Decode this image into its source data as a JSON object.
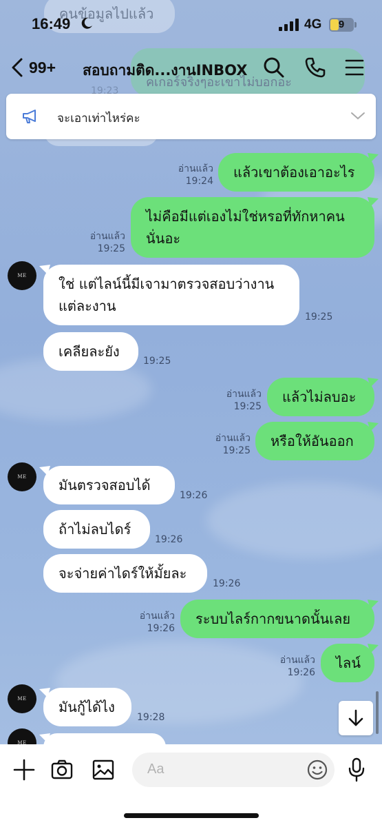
{
  "status_bar": {
    "time": "16:49",
    "network": "4G",
    "battery": "9"
  },
  "header": {
    "back_count": "99+",
    "title": "สอบถามติด...งานINBOX"
  },
  "announcement": {
    "text": "จะเอาเท่าไหร่คะ"
  },
  "background_text": {
    "top_left": "คนข้อมูลไปแล้ว",
    "top_right": "คเกอร์จริงๆอะเขาไม่บอกอะ",
    "time_19_23": "19:23"
  },
  "avatar_label": "ME",
  "messages": [
    {
      "dir": "out",
      "text": "แล้วเขาต้องเอาอะไร",
      "read": "อ่านแล้ว",
      "time": "19:24"
    },
    {
      "dir": "out",
      "text": "ไม่คือมีแต่เองไม่ใช่หรอที่ทักหาคน นั่นอะ",
      "read": "อ่านแล้ว",
      "time": "19:25"
    },
    {
      "dir": "in",
      "text": "ใช่ แต่ไลน์นี้มีเจามาตรวจสอบว่างาน แต่ละงาน",
      "time": "19:25"
    },
    {
      "dir": "in",
      "text": "เคลียละยัง",
      "time": "19:25"
    },
    {
      "dir": "out",
      "text": "แล้วไม่ลบอะ",
      "read": "อ่านแล้ว",
      "time": "19:25"
    },
    {
      "dir": "out",
      "text": "หรือให้อันออก",
      "read": "อ่านแล้ว",
      "time": "19:25"
    },
    {
      "dir": "in",
      "text": "มันตรวจสอบได้",
      "time": "19:26"
    },
    {
      "dir": "in",
      "text": "ถ้าไม่ลบไดร์",
      "time": "19:26"
    },
    {
      "dir": "in",
      "text": "จะจ่ายค่าไดร์ให้มั้ยละ",
      "time": "19:26"
    },
    {
      "dir": "out",
      "text": "ระบบไลร์กากขนาดนั้นเลย",
      "read": "อ่านแล้ว",
      "time": "19:26"
    },
    {
      "dir": "out",
      "text": "ไลน์",
      "read": "อ่านแล้ว",
      "time": "19:26"
    },
    {
      "dir": "in",
      "text": "มันกู้ได้ไง",
      "time": "19:28"
    }
  ],
  "input": {
    "placeholder": "Aa"
  },
  "colors": {
    "outgoing_bubble": "#6ce07a",
    "incoming_bubble": "#ffffff",
    "background": "#9ab4dc",
    "accent": "#4a7bd8"
  }
}
